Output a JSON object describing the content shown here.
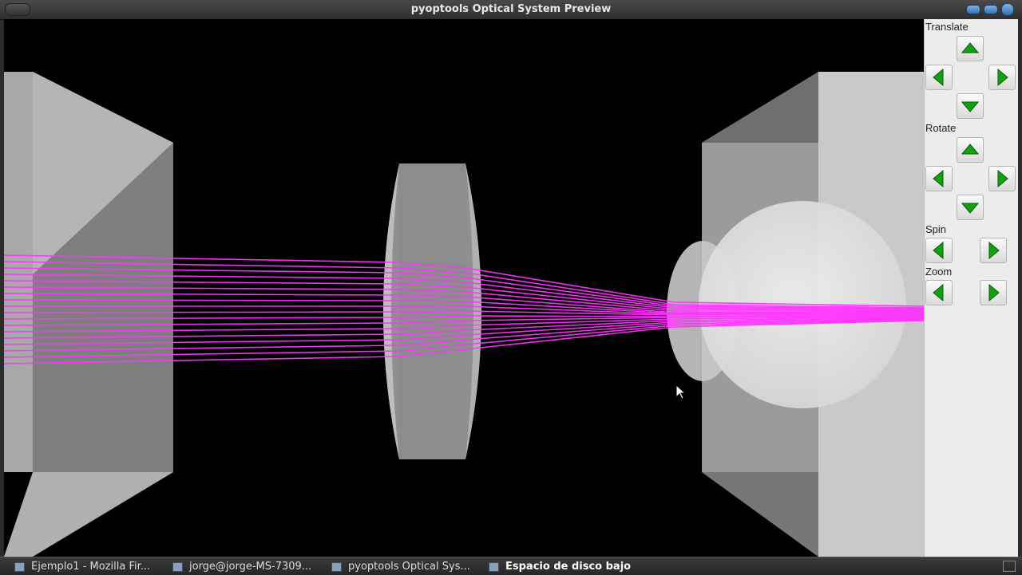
{
  "window": {
    "title": "pyoptools Optical System Preview"
  },
  "controls": {
    "translate_label": "Translate",
    "rotate_label": "Rotate",
    "spin_label": "Spin",
    "zoom_label": "Zoom"
  },
  "scene": {
    "background_color": "#000000",
    "object_color": "#c8c8c8",
    "ray_color": "#ff33ff",
    "objects": [
      "prism",
      "biconvex-lens",
      "ball-lens",
      "prism"
    ]
  },
  "taskbar": {
    "items": [
      {
        "label": "Ejemplo1 - Mozilla Fir...",
        "icon": "firefox-icon"
      },
      {
        "label": "jorge@jorge-MS-7309...",
        "icon": "terminal-icon"
      },
      {
        "label": "pyoptools Optical Sys...",
        "icon": "window-icon"
      },
      {
        "label": "Espacio de disco bajo",
        "icon": "disk-icon",
        "active": true
      }
    ]
  }
}
